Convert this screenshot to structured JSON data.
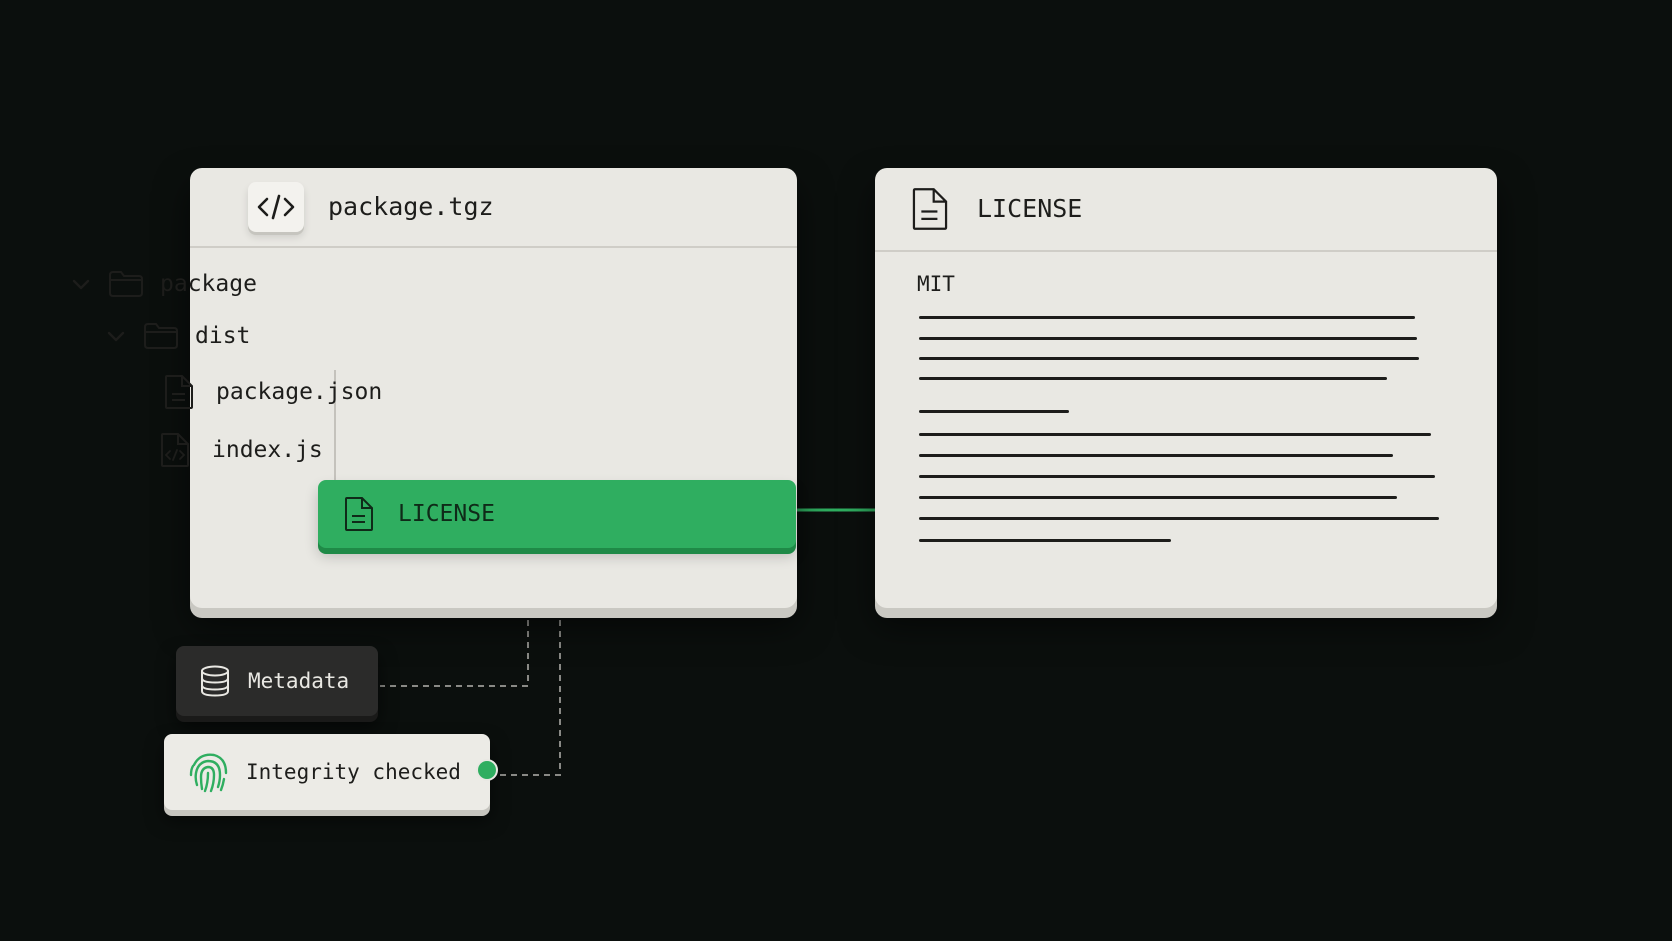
{
  "archive": {
    "title": "package.tgz",
    "tree": {
      "root_folder": "package",
      "sub_folder": "dist",
      "files": [
        "package.json",
        "index.js"
      ],
      "selected_file": "LICENSE"
    }
  },
  "license_viewer": {
    "title": "LICENSE",
    "first_line": "MIT"
  },
  "badges": {
    "metadata": "Metadata",
    "integrity": "Integrity checked"
  },
  "colors": {
    "accent_green": "#2fae60",
    "panel": "#e9e8e3",
    "background": "#0b0f0d",
    "dark_badge": "#2b2b2a"
  },
  "icons": [
    "code-icon",
    "chevron-down-icon",
    "folder-icon",
    "text-file-icon",
    "code-file-icon",
    "database-icon",
    "fingerprint-icon"
  ]
}
